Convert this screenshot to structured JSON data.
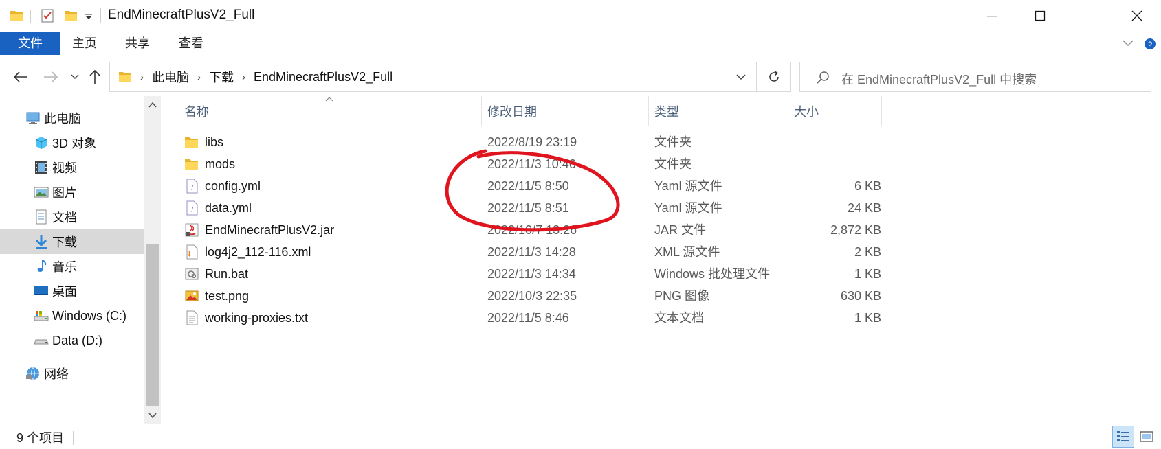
{
  "window": {
    "title": "EndMinecraftPlusV2_Full"
  },
  "ribbon": {
    "tabs": [
      {
        "label": "文件",
        "active": true
      },
      {
        "label": "主页",
        "active": false
      },
      {
        "label": "共享",
        "active": false
      },
      {
        "label": "查看",
        "active": false
      }
    ],
    "accent": "#1a62c2"
  },
  "address": {
    "segments": [
      "此电脑",
      "下载",
      "EndMinecraftPlusV2_Full"
    ]
  },
  "search": {
    "placeholder": "在 EndMinecraftPlusV2_Full 中搜索"
  },
  "nav": {
    "items": [
      {
        "label": "此电脑",
        "icon": "computer-icon",
        "selected": false
      },
      {
        "label": "3D 对象",
        "icon": "3d-objects-icon",
        "selected": false
      },
      {
        "label": "视频",
        "icon": "video-icon",
        "selected": false
      },
      {
        "label": "图片",
        "icon": "pictures-icon",
        "selected": false
      },
      {
        "label": "文档",
        "icon": "documents-icon",
        "selected": false
      },
      {
        "label": "下载",
        "icon": "downloads-icon",
        "selected": true
      },
      {
        "label": "音乐",
        "icon": "music-icon",
        "selected": false
      },
      {
        "label": "桌面",
        "icon": "desktop-icon",
        "selected": false
      },
      {
        "label": "Windows (C:)",
        "icon": "drive-c-icon",
        "selected": false
      },
      {
        "label": "Data (D:)",
        "icon": "drive-icon",
        "selected": false
      },
      {
        "label": "网络",
        "icon": "network-icon",
        "selected": false
      }
    ]
  },
  "columns": {
    "name": "名称",
    "date": "修改日期",
    "type": "类型",
    "size": "大小"
  },
  "files": [
    {
      "name": "libs",
      "date": "2022/8/19 23:19",
      "type": "文件夹",
      "size": "",
      "icon": "folder-icon"
    },
    {
      "name": "mods",
      "date": "2022/11/3 10:46",
      "type": "文件夹",
      "size": "",
      "icon": "folder-icon"
    },
    {
      "name": "config.yml",
      "date": "2022/11/5 8:50",
      "type": "Yaml 源文件",
      "size": "6 KB",
      "icon": "yaml-file-icon"
    },
    {
      "name": "data.yml",
      "date": "2022/11/5 8:51",
      "type": "Yaml 源文件",
      "size": "24 KB",
      "icon": "yaml-file-icon"
    },
    {
      "name": "EndMinecraftPlusV2.jar",
      "date": "2022/10/7 13:26",
      "type": "JAR 文件",
      "size": "2,872 KB",
      "icon": "java-jar-icon"
    },
    {
      "name": "log4j2_112-116.xml",
      "date": "2022/11/3 14:28",
      "type": "XML 源文件",
      "size": "2 KB",
      "icon": "xml-file-icon"
    },
    {
      "name": "Run.bat",
      "date": "2022/11/3 14:34",
      "type": "Windows 批处理文件",
      "size": "1 KB",
      "icon": "batch-file-icon"
    },
    {
      "name": "test.png",
      "date": "2022/10/3 22:35",
      "type": "PNG 图像",
      "size": "630 KB",
      "icon": "image-file-icon"
    },
    {
      "name": "working-proxies.txt",
      "date": "2022/11/5 8:46",
      "type": "文本文档",
      "size": "1 KB",
      "icon": "text-file-icon"
    }
  ],
  "status": {
    "count": "9 个项目"
  },
  "annotation_color": "#e0141e"
}
